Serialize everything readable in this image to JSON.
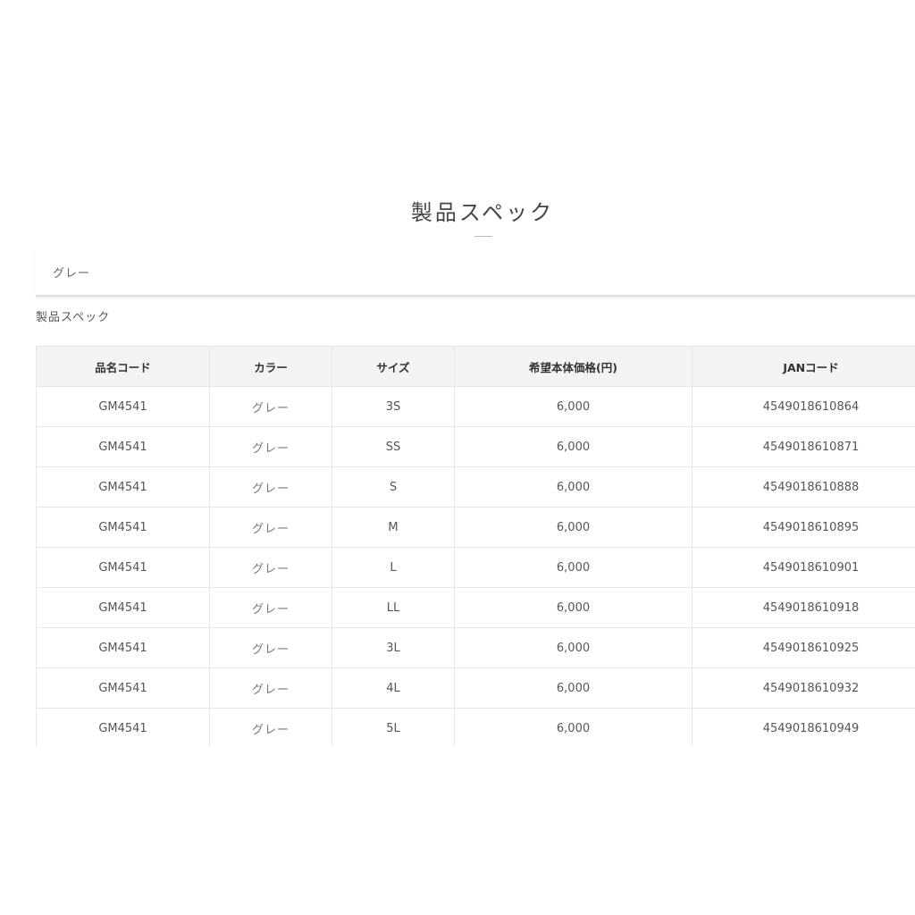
{
  "section": {
    "title": "製品スペック"
  },
  "color_tab": {
    "label": "グレー"
  },
  "spec": {
    "heading": "製品スペック",
    "columns": [
      "品名コード",
      "カラー",
      "サイズ",
      "希望本体価格(円)",
      "JANコード"
    ],
    "rows": [
      [
        "GM4541",
        "グレー",
        "3S",
        "6,000",
        "4549018610864"
      ],
      [
        "GM4541",
        "グレー",
        "SS",
        "6,000",
        "4549018610871"
      ],
      [
        "GM4541",
        "グレー",
        "S",
        "6,000",
        "4549018610888"
      ],
      [
        "GM4541",
        "グレー",
        "M",
        "6,000",
        "4549018610895"
      ],
      [
        "GM4541",
        "グレー",
        "L",
        "6,000",
        "4549018610901"
      ],
      [
        "GM4541",
        "グレー",
        "LL",
        "6,000",
        "4549018610918"
      ],
      [
        "GM4541",
        "グレー",
        "3L",
        "6,000",
        "4549018610925"
      ],
      [
        "GM4541",
        "グレー",
        "4L",
        "6,000",
        "4549018610932"
      ],
      [
        "GM4541",
        "グレー",
        "5L",
        "6,000",
        "4549018610949"
      ]
    ]
  }
}
